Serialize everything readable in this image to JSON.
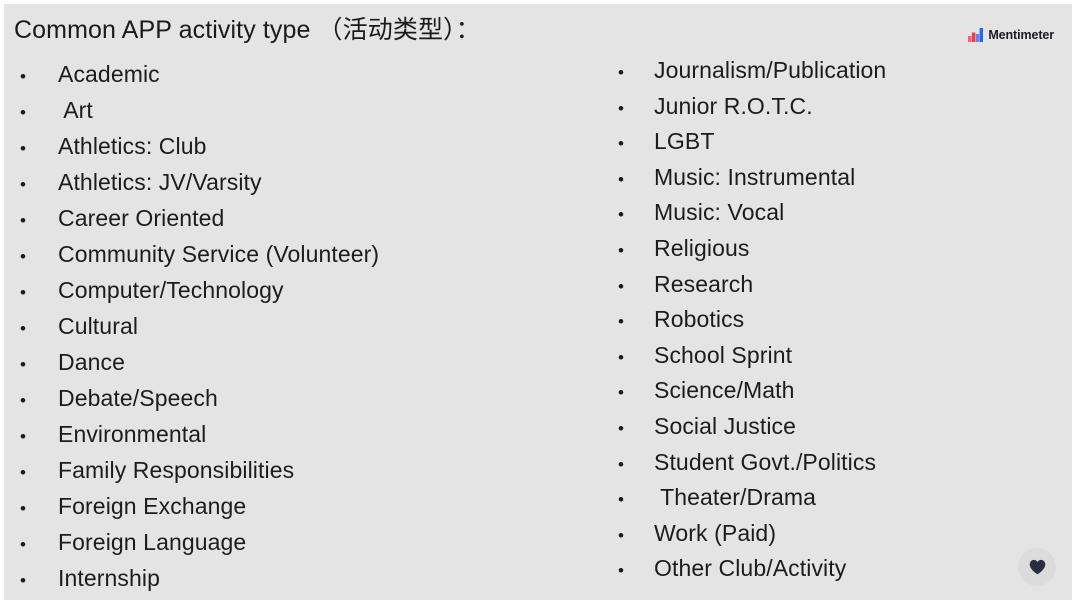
{
  "slide": {
    "title": "Common APP activity type （活动类型）：",
    "background_color": "#e5e4e4",
    "text_color": "#1c1c1c",
    "bullet_glyph": "•"
  },
  "left_column": {
    "items": [
      "Academic",
      " Art",
      "Athletics: Club",
      "Athletics: JV/Varsity",
      "Career Oriented",
      "Community Service (Volunteer)",
      "Computer/Technology",
      "Cultural",
      "Dance",
      "Debate/Speech",
      "Environmental",
      "Family Responsibilities",
      "Foreign Exchange",
      "Foreign Language",
      "Internship"
    ]
  },
  "right_column": {
    "items": [
      "Journalism/Publication",
      "Junior R.O.T.C.",
      "LGBT",
      "Music: Instrumental",
      "Music: Vocal",
      "Religious",
      "Research",
      "Robotics",
      "School Sprint",
      "Science/Math",
      "Social Justice",
      "Student Govt./Politics",
      " Theater/Drama",
      "Work (Paid)",
      "Other Club/Activity"
    ]
  },
  "branding": {
    "wordmark": "Mentimeter",
    "logo_icon": "mentimeter-bars-icon",
    "logo_colors": {
      "pink": "#f45d8c",
      "red": "#e8413f",
      "blue": "#196cff",
      "dark": "#1b1b24"
    }
  },
  "actions": {
    "heart_icon": "heart-icon",
    "heart_color": "#2b2d42",
    "heart_bg": "#dcdbdb"
  }
}
